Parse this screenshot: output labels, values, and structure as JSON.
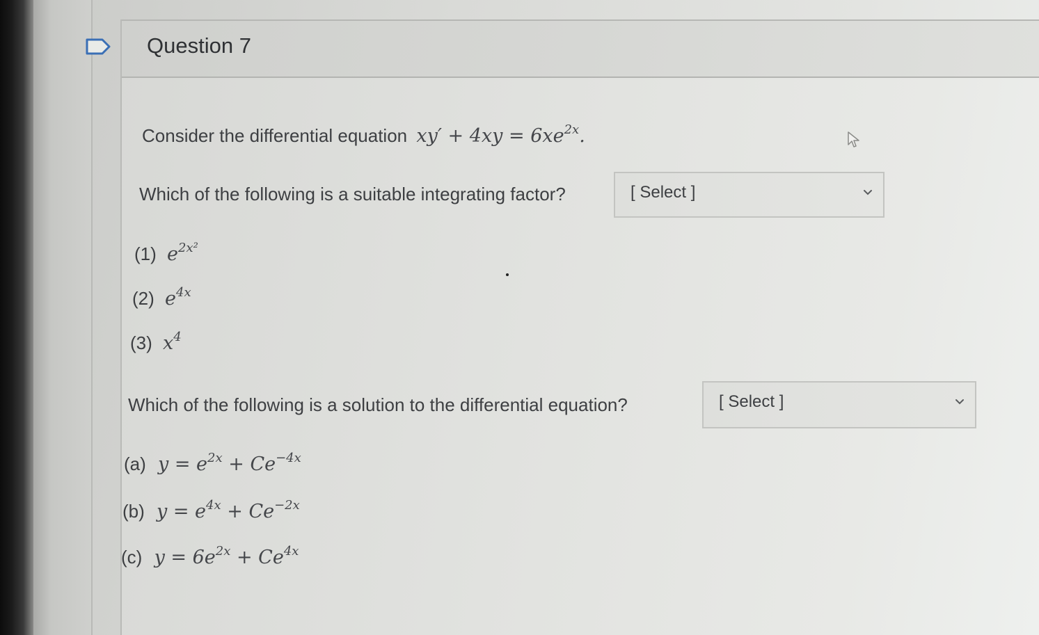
{
  "question": {
    "title": "Question 7",
    "intro": "Consider the differential equation",
    "equation": {
      "lhs": "xy′ + 4xy = 6xe",
      "lhs_sup": "2x",
      "end": "."
    }
  },
  "part1": {
    "prompt": "Which of the following is a suitable integrating factor?",
    "select_label": "[ Select ]",
    "options": [
      {
        "label": "(1)",
        "base": "e",
        "sup": "2x²"
      },
      {
        "label": "(2)",
        "base": "e",
        "sup": "4x"
      },
      {
        "label": "(3)",
        "base": "x",
        "sup": "4"
      }
    ]
  },
  "part2": {
    "prompt": "Which of the following is a solution to the differential equation?",
    "select_label": "[ Select ]",
    "options": [
      {
        "label": "(a)",
        "p1": "y = e",
        "s1": "2x",
        "p2": " + Ce",
        "s2": "−4x"
      },
      {
        "label": "(b)",
        "p1": "y = e",
        "s1": "4x",
        "p2": " + Ce",
        "s2": "−2x"
      },
      {
        "label": "(c)",
        "p1": "y = 6e",
        "s1": "2x",
        "p2": " + Ce",
        "s2": "4x"
      }
    ]
  },
  "icons": {
    "flag": "flag-icon",
    "chevron": "chevron-down-icon",
    "cursor": "mouse-cursor-icon"
  },
  "colors": {
    "background": "#e3e4e1",
    "header": "#d6d7d4",
    "text": "#3d3f42"
  }
}
